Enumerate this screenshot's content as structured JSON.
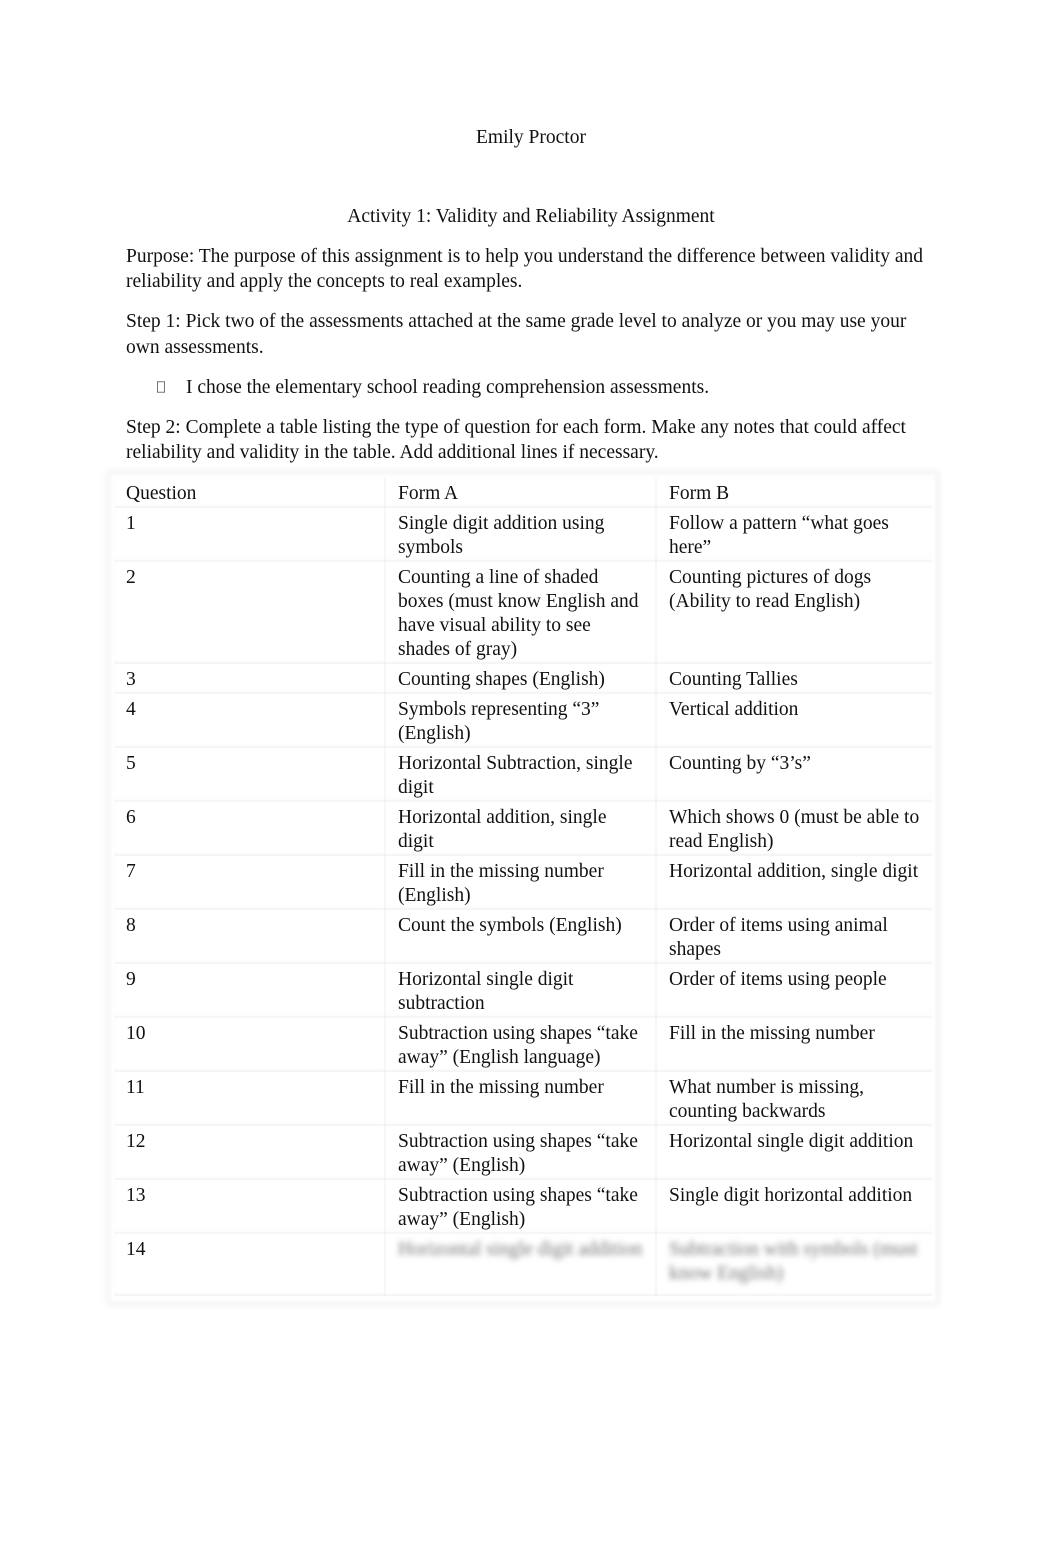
{
  "document": {
    "author": "Emily Proctor",
    "title": "Activity 1: Validity and Reliability Assignment",
    "purpose": "Purpose:  The purpose of this assignment is to help you understand the difference between validity and reliability and apply the concepts to real examples.",
    "step1": "Step 1:  Pick two of the assessments attached at the same grade level to analyze or you may use your own assessments.",
    "bullet_icon": "missing-glyph-bullet",
    "bullet_text": "I chose the elementary school reading comprehension assessments.",
    "step2": "Step 2:  Complete a table listing the type of question for each form.  Make any notes that could affect reliability and validity in the table.  Add additional lines if necessary."
  },
  "table": {
    "headers": [
      "Question",
      "Form A",
      "Form B"
    ],
    "rows": [
      {
        "question": "1",
        "form_a": "Single digit addition using symbols",
        "form_b": "Follow a pattern “what goes here”"
      },
      {
        "question": "2",
        "form_a": "Counting a line of shaded boxes (must know English and have visual ability to see shades of gray)",
        "form_b": "Counting pictures of dogs (Ability to read English)"
      },
      {
        "question": "3",
        "form_a": "Counting shapes (English)",
        "form_b": "Counting Tallies"
      },
      {
        "question": "4",
        "form_a": "Symbols representing “3” (English)",
        "form_b": "Vertical addition"
      },
      {
        "question": "5",
        "form_a": "Horizontal Subtraction, single digit",
        "form_b": "Counting by “3’s”"
      },
      {
        "question": "6",
        "form_a": "Horizontal addition, single digit",
        "form_b": "Which shows 0 (must be able to read English)"
      },
      {
        "question": "7",
        "form_a": "Fill in the missing number (English)",
        "form_b": "Horizontal addition, single digit"
      },
      {
        "question": "8",
        "form_a": "Count the symbols (English)",
        "form_b": "Order of items using animal shapes"
      },
      {
        "question": "9",
        "form_a": "Horizontal single digit subtraction",
        "form_b": "Order of items using people"
      },
      {
        "question": "10",
        "form_a": "Subtraction using shapes “take away” (English language)",
        "form_b": "Fill in the missing number"
      },
      {
        "question": "11",
        "form_a": "Fill in the missing number",
        "form_b": "What number is missing, counting backwards"
      },
      {
        "question": "12",
        "form_a": "Subtraction using shapes “take away” (English)",
        "form_b": "Horizontal single digit addition"
      },
      {
        "question": "13",
        "form_a": "Subtraction using shapes “take away” (English)",
        "form_b": "Single digit horizontal addition"
      },
      {
        "question": "14",
        "form_a": "Horizontal single digit addition",
        "form_b": "Subtraction with symbols (must know English)"
      }
    ],
    "blurred_row_index": 13
  }
}
